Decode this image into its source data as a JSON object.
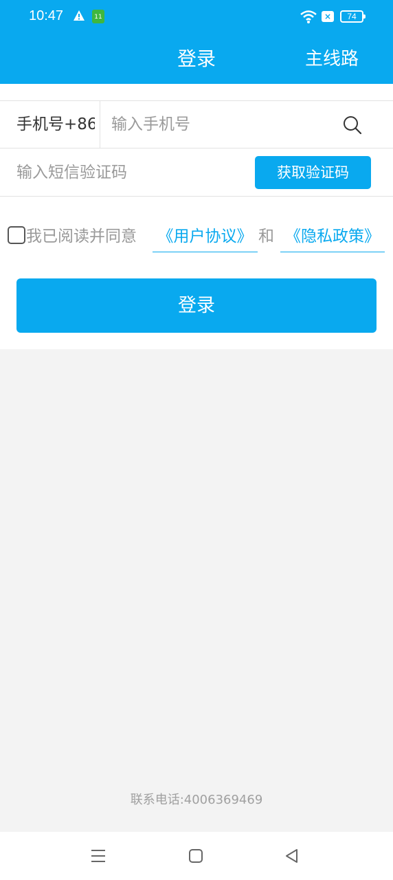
{
  "status_bar": {
    "time": "10:47",
    "app_badge": "11",
    "battery": "74",
    "x_badge": "×"
  },
  "header": {
    "title": "登录",
    "route_label": "主线路"
  },
  "phone_row": {
    "prefix_label": "手机号+86",
    "placeholder": "输入手机号"
  },
  "code_row": {
    "placeholder": "输入短信验证码",
    "get_code_label": "获取验证码"
  },
  "agreement": {
    "text": "我已阅读并同意",
    "user_agreement": "《用户协议》",
    "and": "和",
    "privacy_policy": "《隐私政策》"
  },
  "login_button_label": "登录",
  "footer": {
    "contact": "联系电话:4006369469"
  },
  "colors": {
    "accent": "#09a9ef",
    "background": "#f3f3f3"
  }
}
